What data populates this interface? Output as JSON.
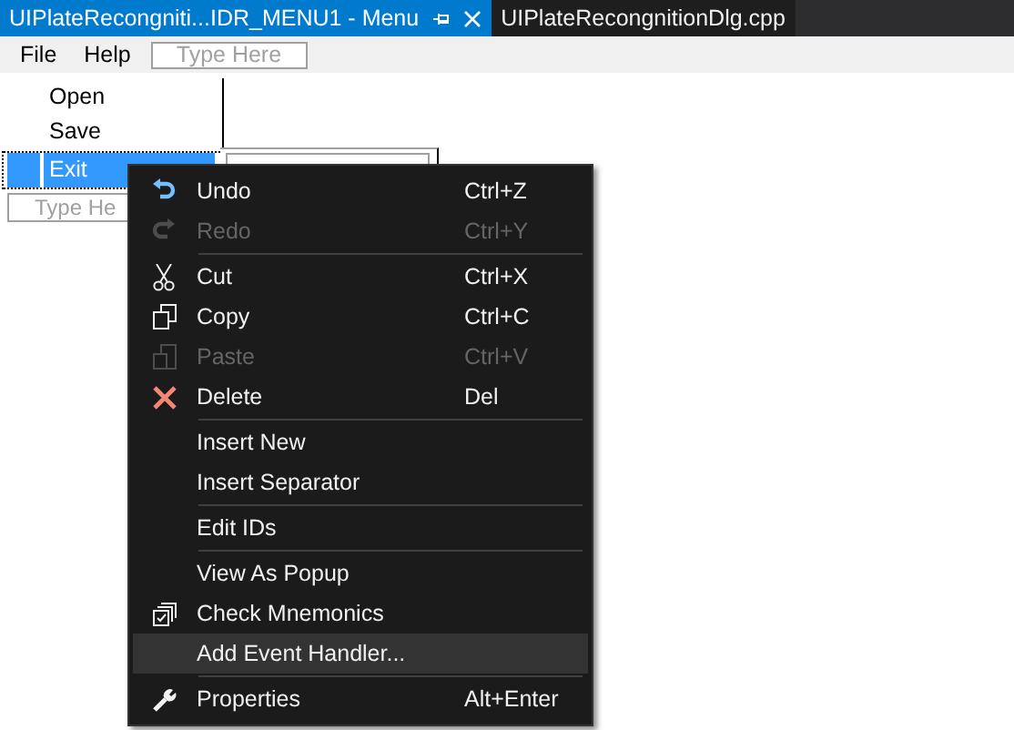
{
  "tabs": [
    {
      "label": "UIPlateRecongniti...IDR_MENU1 - Menu",
      "selected": true
    },
    {
      "label": "UIPlateRecongnitionDlg.cpp",
      "selected": false
    }
  ],
  "menubar": {
    "items": [
      "File",
      "Help"
    ],
    "placeholder": "Type Here"
  },
  "dropdown": {
    "items": [
      {
        "label": "Open",
        "selected": false
      },
      {
        "label": "Save",
        "selected": false
      },
      {
        "label": "Exit",
        "selected": true
      }
    ],
    "placeholder": "Type He"
  },
  "context_menu": [
    {
      "kind": "item",
      "label": "Undo",
      "shortcut": "Ctrl+Z",
      "disabled": false,
      "selected": false
    },
    {
      "kind": "item",
      "label": "Redo",
      "shortcut": "Ctrl+Y",
      "disabled": true,
      "selected": false
    },
    {
      "kind": "separator"
    },
    {
      "kind": "item",
      "label": "Cut",
      "shortcut": "Ctrl+X",
      "disabled": false,
      "selected": false
    },
    {
      "kind": "item",
      "label": "Copy",
      "shortcut": "Ctrl+C",
      "disabled": false,
      "selected": false
    },
    {
      "kind": "item",
      "label": "Paste",
      "shortcut": "Ctrl+V",
      "disabled": true,
      "selected": false
    },
    {
      "kind": "item",
      "label": "Delete",
      "shortcut": "Del",
      "disabled": false,
      "selected": false
    },
    {
      "kind": "separator"
    },
    {
      "kind": "item",
      "label": "Insert New",
      "disabled": false,
      "selected": false
    },
    {
      "kind": "item",
      "label": "Insert Separator",
      "disabled": false,
      "selected": false
    },
    {
      "kind": "separator"
    },
    {
      "kind": "item",
      "label": "Edit IDs",
      "disabled": false,
      "selected": false
    },
    {
      "kind": "separator"
    },
    {
      "kind": "item",
      "label": "View As Popup",
      "disabled": false,
      "selected": false
    },
    {
      "kind": "item",
      "label": "Check Mnemonics",
      "disabled": false,
      "selected": false
    },
    {
      "kind": "item",
      "label": "Add Event Handler...",
      "disabled": false,
      "selected": true
    },
    {
      "kind": "separator"
    },
    {
      "kind": "item",
      "label": "Properties",
      "shortcut": "Alt+Enter",
      "disabled": false,
      "selected": false
    }
  ]
}
